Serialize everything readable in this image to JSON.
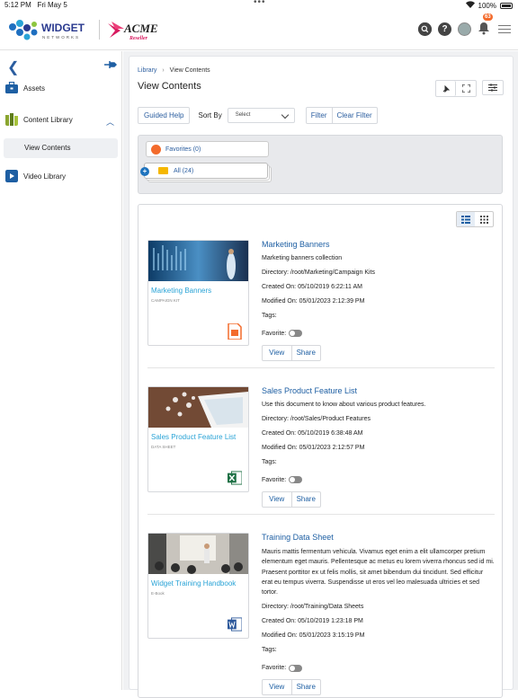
{
  "status_bar": {
    "time": "5:12 PM",
    "date": "Fri May 5",
    "battery": "100%"
  },
  "header": {
    "logo1_main": "WIDGET",
    "logo1_sub": "NETWORKS",
    "logo2_main": "ACME",
    "logo2_sub": "Reseller",
    "notification_count": "63"
  },
  "sidebar": {
    "items": [
      {
        "label": "Assets"
      },
      {
        "label": "Content Library"
      },
      {
        "label": "View Contents"
      },
      {
        "label": "Video Library"
      }
    ]
  },
  "breadcrumb": {
    "root": "Library",
    "current": "View Contents"
  },
  "page_title": "View Contents",
  "toolbar": {
    "guided_help": "Guided Help",
    "sort_by_label": "Sort By",
    "sort_select": "Select",
    "filter": "Filter",
    "clear_filter": "Clear Filter"
  },
  "folders": {
    "favorites": "Favorites (0)",
    "all": "All (24)"
  },
  "labels": {
    "directory": "Directory:",
    "created_on": "Created On:",
    "modified_on": "Modified On:",
    "tags": "Tags:",
    "favorite": "Favorite:",
    "view": "View",
    "share": "Share"
  },
  "items": [
    {
      "title": "Marketing Banners",
      "card_title": "Marketing Banners",
      "card_type": "CAMPAIGN KIT",
      "description": "Marketing banners collection",
      "directory": "/root/Marketing/Campaign Kits",
      "created_on": "05/10/2019 6:22:11 AM",
      "modified_on": "05/01/2023 2:12:39 PM",
      "file_icon": "document-icon",
      "color": "#f36b2c"
    },
    {
      "title": "Sales Product Feature List",
      "card_title": "Sales Product Feature List",
      "card_type": "DATA SHEET",
      "description": "Use this document to know about various product features.",
      "directory": "/root/Sales/Product Features",
      "created_on": "05/10/2019 6:38:48 AM",
      "modified_on": "05/01/2023 2:12:57 PM",
      "file_icon": "excel-icon",
      "color": "#1d7044"
    },
    {
      "title": "Training Data Sheet",
      "card_title": "Widget Training Handbook",
      "card_type": "E-Book",
      "description": "Mauris mattis fermentum vehicula. Vivamus eget enim a elit ullamcorper pretium elementum eget mauris. Pellentesque ac metus eu lorem viverra rhoncus sed id mi. Praesent porttitor ex ut felis mollis, sit amet bibendum dui tincidunt. Sed efficitur erat eu tempus viverra. Suspendisse ut eros vel leo malesuada ultricies et sed tortor.",
      "directory": "/root/Training/Data Sheets",
      "created_on": "05/10/2019 1:23:18 PM",
      "modified_on": "05/01/2023 3:15:19 PM",
      "file_icon": "word-icon",
      "color": "#2b579a"
    }
  ]
}
